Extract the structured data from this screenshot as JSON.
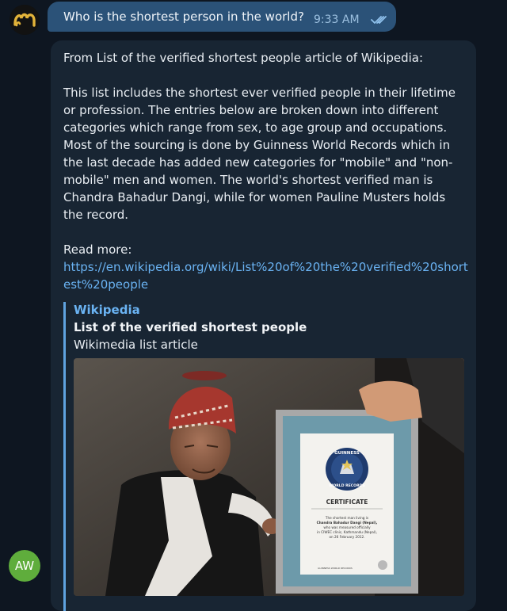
{
  "bot_avatar": {
    "icon": "bot-logo-icon"
  },
  "user_message": {
    "text": "Who is the shortest person in the world?",
    "time": "9:33 AM",
    "status_icon": "double-check-icon"
  },
  "reply": {
    "intro": "From List of the verified shortest people article of Wikipedia:",
    "body_lines": [
      "This list includes the shortest ever verified people in their lifetime",
      "or profession. The entries below are broken down into different",
      "categories which range from sex, to age group and occupations.",
      "Most of the sourcing is done by Guinness World Records which in",
      "the last decade has added new categories for \"mobile\" and \"non-",
      "mobile\" men and women. The world's shortest verified man is",
      "Chandra Bahadur Dangi, while for women Pauline Musters holds",
      "the record."
    ],
    "read_more_label": "Read more:",
    "link_lines": [
      "https://en.wikipedia.org/wiki/List%20of%20the%20verified%20short",
      "est%20people"
    ]
  },
  "link_preview": {
    "site": "Wikipedia",
    "title": "List of the verified shortest people",
    "description": "Wikimedia list article",
    "certificate": {
      "badge_top": "GUINNESS",
      "badge_bottom": "WORLD RECORDS",
      "heading": "CERTIFICATE",
      "lines": [
        "The shortest man living is",
        "Chandra Bahadur Dangi (Nepal),",
        "who was measured officially",
        "in CIWEC clinic, Kathmandu (Nepal),",
        "on 26 February 2012."
      ],
      "footer": "GUINNESS WORLD RECORDS"
    }
  },
  "user_avatar": {
    "initials": "AW"
  },
  "colors": {
    "background": "#0e1621",
    "outgoing_bubble": "#2b5278",
    "incoming_bubble": "#182533",
    "link": "#6ab3f3",
    "avatar": "#5fad3c"
  }
}
